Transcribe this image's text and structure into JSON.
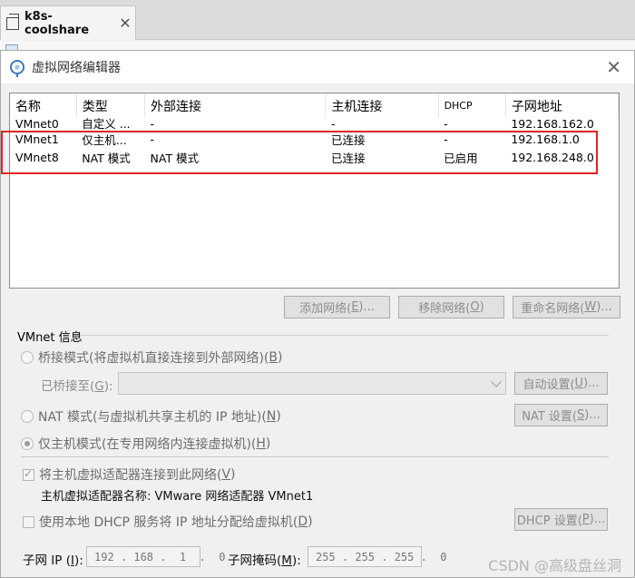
{
  "app_tab": {
    "title": "k8s-coolshare",
    "close": "✕"
  },
  "dialog": {
    "title": "虚拟网络编辑器",
    "close": "✕"
  },
  "network_table": {
    "columns": [
      "名称",
      "类型",
      "外部连接",
      "主机连接",
      "DHCP",
      "子网地址"
    ],
    "rows": [
      [
        "VMnet0",
        "自定义 ...",
        "-",
        "-",
        "-",
        "192.168.162.0"
      ],
      [
        "VMnet1",
        "仅主机...",
        "-",
        "已连接",
        "-",
        "192.168.1.0"
      ],
      [
        "VMnet8",
        "NAT 模式",
        "NAT 模式",
        "已连接",
        "已启用",
        "192.168.248.0"
      ]
    ]
  },
  "list_buttons": {
    "add_prefix": "添加网络(",
    "add_key": "E",
    "add_suffix": ")...",
    "remove_prefix": "移除网络(",
    "remove_key": "O",
    "remove_suffix": ")",
    "rename_prefix": "重命名网络(",
    "rename_key": "W",
    "rename_suffix": ")..."
  },
  "vmnet_info": {
    "group_label": "VMnet 信息",
    "bridge": {
      "prefix": "桥接模式(将虚拟机直接连接到外部网络)(",
      "key": "B",
      "suffix": ")",
      "selected": false
    },
    "bridged_to": {
      "prefix": "已桥接至(",
      "key": "G",
      "suffix": "):",
      "value": ""
    },
    "auto_button": {
      "prefix": "自动设置(",
      "key": "U",
      "suffix": ")..."
    },
    "nat": {
      "prefix": "NAT 模式(与虚拟机共享主机的 IP 地址)(",
      "key": "N",
      "suffix": ")",
      "selected": false
    },
    "nat_button": {
      "prefix": "NAT 设置(",
      "key": "S",
      "suffix": ")..."
    },
    "host_only": {
      "prefix": "仅主机模式(在专用网络内连接虚拟机)(",
      "key": "H",
      "suffix": ")",
      "selected": true
    },
    "connect_adapter": {
      "prefix": "将主机虚拟适配器连接到此网络(",
      "key": "V",
      "suffix": ")",
      "checked": true
    },
    "adapter_name": "主机虚拟适配器名称: VMware 网络适配器 VMnet1",
    "dhcp": {
      "prefix": "使用本地 DHCP 服务将 IP 地址分配给虚拟机(",
      "key": "D",
      "suffix": ")",
      "checked": false
    },
    "dhcp_button": {
      "prefix": "DHCP 设置(",
      "key": "P",
      "suffix": ")..."
    },
    "subnet_ip": {
      "prefix": "子网 IP (",
      "key": "I",
      "suffix": "):",
      "value": "192 . 168 .  1  .  0"
    },
    "subnet_mask": {
      "prefix": "子网掩码(",
      "key": "M",
      "suffix": "):",
      "value": "255 . 255 . 255 .  0"
    }
  },
  "watermark": "CSDN @高级盘丝洞",
  "colors": {
    "highlight": "#e12222",
    "disabled_text": "#8c8c8c"
  }
}
